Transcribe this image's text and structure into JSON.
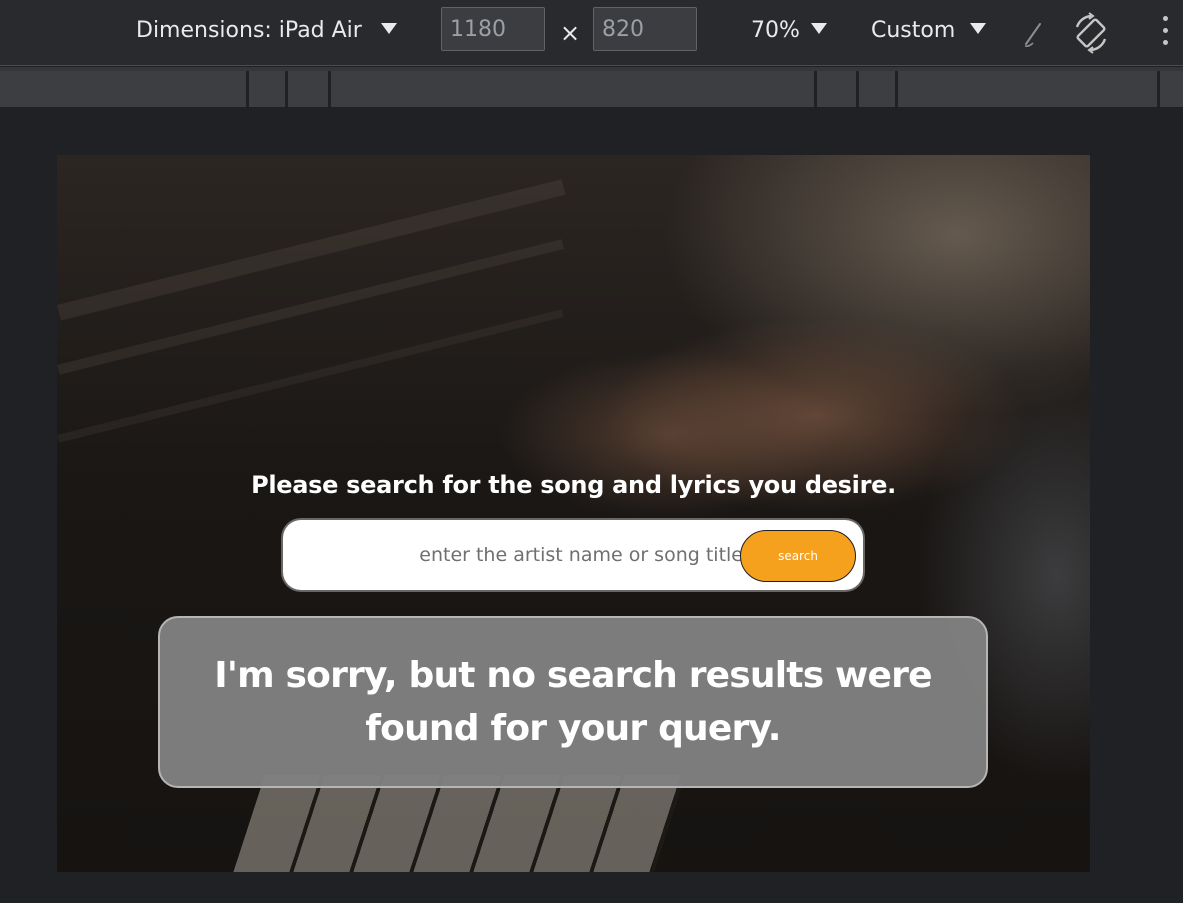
{
  "devtools": {
    "dimensions_label": "Dimensions: iPad Air",
    "width_value": "1180",
    "height_value": "820",
    "times_symbol": "×",
    "zoom_label": "70%",
    "throttle_label": "Custom",
    "icons": {
      "dimensions_dropdown": "caret-down-icon",
      "zoom_dropdown": "caret-down-icon",
      "throttle_dropdown": "caret-down-icon",
      "disabled_pen": "pen-icon",
      "rotate": "rotate-icon",
      "more": "kebab-menu-icon"
    }
  },
  "page": {
    "title": "Please search for the song and lyrics you desire.",
    "search": {
      "placeholder": "enter the artist name or song title",
      "value": "",
      "button_label": "search"
    },
    "no_results_message": "I'm sorry, but no search results were found for your query."
  },
  "colors": {
    "toolbar_bg": "#292a2d",
    "canvas_bg": "#202124",
    "search_button": "#f6a11e",
    "message_box": "#808080"
  }
}
